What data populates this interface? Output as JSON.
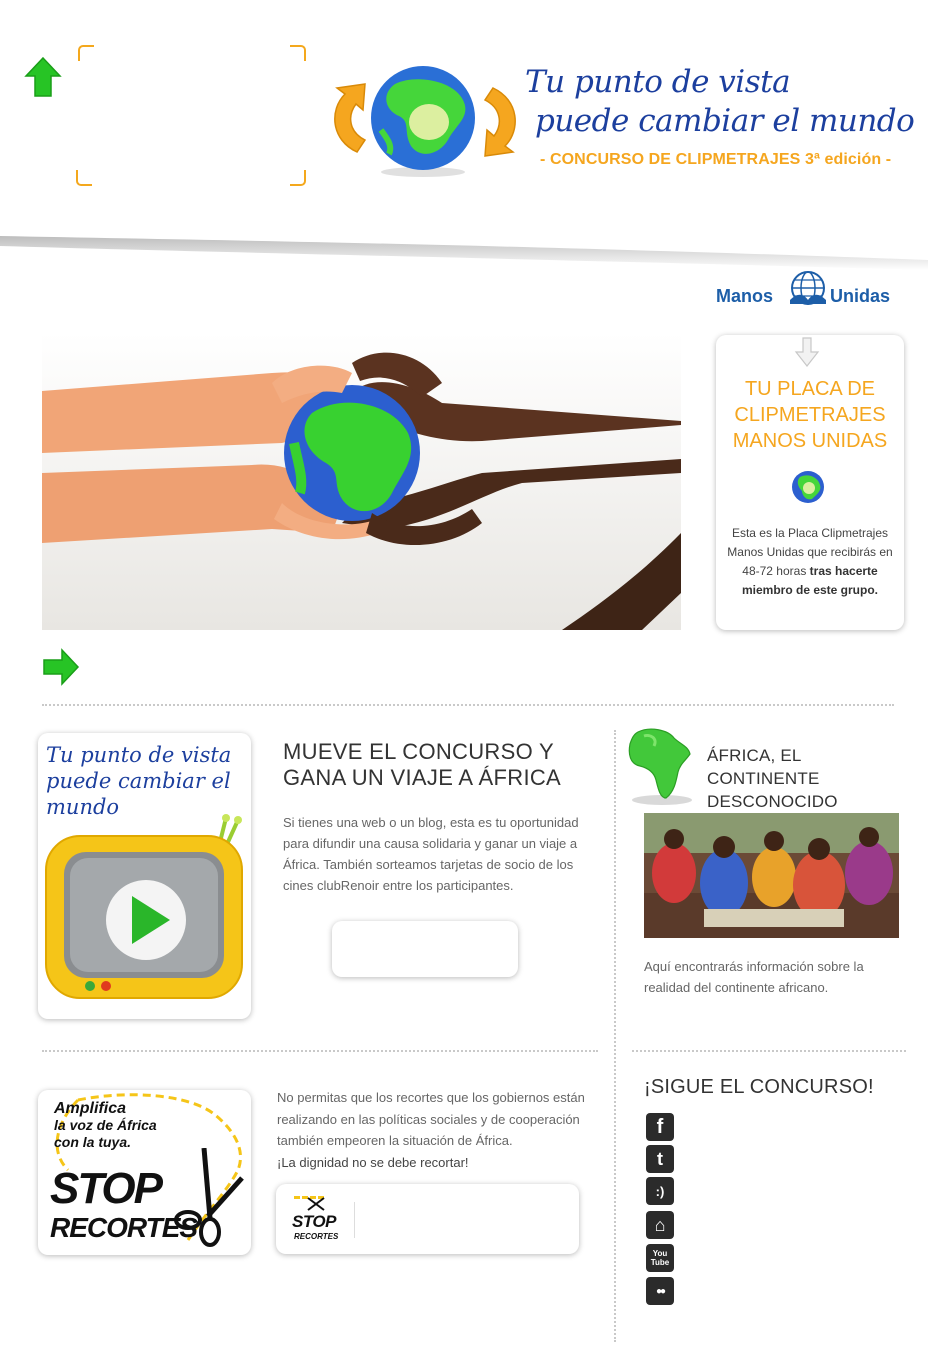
{
  "header": {
    "slogan_line1": "Tu punto de vista",
    "slogan_line2": "puede cambiar el mundo",
    "contest_line": "- CONCURSO DE CLIPMETRAJES 3ª edición -"
  },
  "brand": {
    "name_left": "Manos",
    "name_right": "Unidas",
    "color_blue": "#1d5ea8",
    "color_orange": "#f5a61f",
    "color_green": "#2fc62a"
  },
  "placa": {
    "title": "TU PLACA DE CLIPMETRAJES MANOS UNIDAS",
    "text_normal": "Esta es la Placa Clipmetrajes Manos Unidas que recibirás en 48-72 horas ",
    "text_bold": "tras hacerte miembro de este grupo."
  },
  "mueve": {
    "tv_slogan": "Tu punto de vista puede cambiar el mundo",
    "title": "MUEVE EL CONCURSO Y GANA UN VIAJE A ÁFRICA",
    "text": "Si tienes una web o un blog, esta es tu oportunidad para difundir una causa solidaria y ganar un viaje a África. También sorteamos tarjetas de socio de los cines clubRenoir entre los participantes."
  },
  "africa": {
    "title": "ÁFRICA, EL CONTINENTE DESCONOCIDO",
    "text": "Aquí encontrarás información sobre la realidad del continente africano."
  },
  "stop": {
    "banner_line1": "Amplifica",
    "banner_line2": "la voz de África",
    "banner_line3": "con la tuya.",
    "banner_big1": "STOP",
    "banner_big2": "RECORTES",
    "text": "No permitas que los recortes que los gobiernos están realizando en las políticas sociales y de cooperación también empeoren la situación de África.",
    "text_em": "¡La dignidad no se debe recortar!",
    "mini_big1": "STOP",
    "mini_big2": "RECORTES"
  },
  "social": {
    "title": "¡SIGUE EL CONCURSO!",
    "icons": [
      {
        "name": "facebook-icon",
        "glyph": "f"
      },
      {
        "name": "twitter-icon",
        "glyph": "t"
      },
      {
        "name": "tuenti-icon",
        "glyph": ":)"
      },
      {
        "name": "home-icon",
        "glyph": "⌂"
      },
      {
        "name": "youtube-icon",
        "glyph": "You Tube"
      },
      {
        "name": "flickr-icon",
        "glyph": "●●"
      }
    ]
  }
}
